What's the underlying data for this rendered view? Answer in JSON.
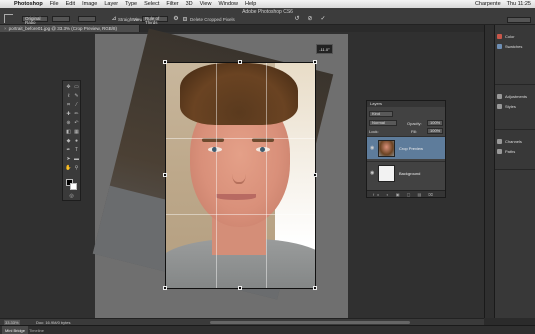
{
  "menubar": {
    "apple": "",
    "app": "Photoshop",
    "items": [
      "File",
      "Edit",
      "Image",
      "Layer",
      "Type",
      "Select",
      "Filter",
      "3D",
      "View",
      "Window",
      "Help"
    ],
    "status_right": [
      "Charpente",
      "Thu 11:25"
    ]
  },
  "window_title": "Adobe Photoshop CS6",
  "options_bar": {
    "ratio_value": "Original Ratio",
    "straighten_label": "Straighten",
    "view_label": "View:",
    "view_value": "Rule of Thirds",
    "delete_cropped_label": "Delete Cropped Pixels"
  },
  "document_tab": {
    "title": "portrait_before01.jpg @ 33.3% (Crop Preview, RGB/8)"
  },
  "canvas": {
    "rotation_degrees": 14,
    "angle_readout": "-11.0°"
  },
  "tools": [
    "move",
    "marquee",
    "lasso",
    "quick-select",
    "crop",
    "eyedropper",
    "healing",
    "brush",
    "clone",
    "history-brush",
    "eraser",
    "gradient",
    "blur",
    "dodge",
    "pen",
    "type",
    "path-select",
    "shape",
    "hand",
    "zoom"
  ],
  "layers_panel": {
    "title": "Layers",
    "kind_filter": "Kind",
    "blend_mode": "Normal",
    "opacity_label": "Opacity:",
    "opacity_value": "100%",
    "lock_label": "Lock:",
    "fill_label": "Fill:",
    "fill_value": "100%",
    "layers": [
      {
        "name": "Crop Preview",
        "active": true
      },
      {
        "name": "Background",
        "active": false
      }
    ],
    "footer_icons": "fx ◐ ▣ ▢ ▤ ⌧"
  },
  "dock": {
    "groups": [
      {
        "items": [
          {
            "label": "Color",
            "icon": "color-icon"
          },
          {
            "label": "Swatches",
            "icon": "swatches-icon"
          }
        ]
      },
      {
        "items": [
          {
            "label": "Adjustments",
            "icon": "adjustments-icon"
          },
          {
            "label": "Styles",
            "icon": "styles-icon"
          }
        ]
      },
      {
        "items": [
          {
            "label": "Channels",
            "icon": "channels-icon"
          },
          {
            "label": "Paths",
            "icon": "paths-icon"
          }
        ]
      }
    ]
  },
  "status_bar": {
    "zoom": "33.33%",
    "doc_info": "Doc: 16.9M/0 bytes"
  },
  "bottom_tabs": [
    {
      "label": "Mini Bridge",
      "active": true
    },
    {
      "label": "Timeline",
      "active": false
    }
  ]
}
